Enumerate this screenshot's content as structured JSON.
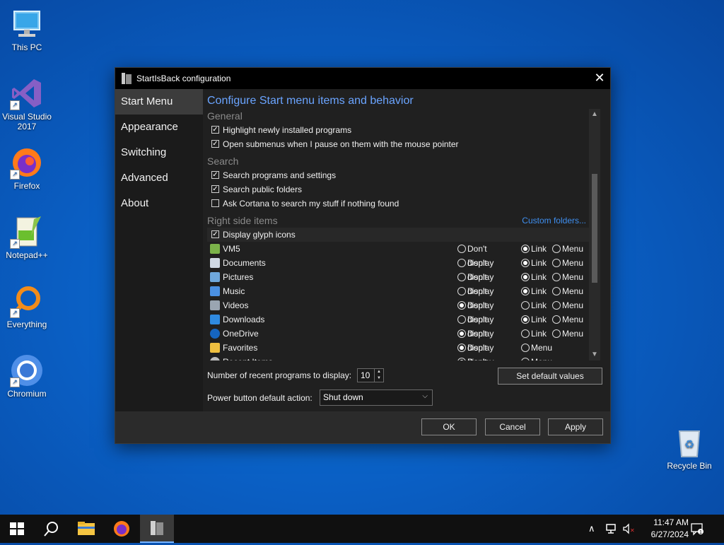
{
  "desktop": {
    "icons": [
      {
        "label": "This PC",
        "icon": "this-pc-icon"
      },
      {
        "label": "Visual Studio 2017",
        "icon": "visual-studio-icon"
      },
      {
        "label": "Firefox",
        "icon": "firefox-icon"
      },
      {
        "label": "Notepad++",
        "icon": "notepadpp-icon"
      },
      {
        "label": "Everything",
        "icon": "everything-icon"
      },
      {
        "label": "Chromium",
        "icon": "chromium-icon"
      },
      {
        "label": "Recycle Bin",
        "icon": "recycle-bin-icon"
      }
    ]
  },
  "dialog": {
    "title": "StartIsBack configuration",
    "close_glyph": "✕",
    "nav": [
      "Start Menu",
      "Appearance",
      "Switching",
      "Advanced",
      "About"
    ],
    "nav_selected": "Start Menu",
    "heading": "Configure Start menu items and behavior",
    "sections": {
      "general": "General",
      "search": "Search",
      "right_side": "Right side items"
    },
    "custom_folders": "Custom folders...",
    "options": {
      "highlight": {
        "label": "Highlight newly installed programs",
        "checked": true
      },
      "submenus": {
        "label": "Open submenus when I pause on them with the mouse pointer",
        "checked": true
      },
      "search_programs": {
        "label": "Search programs and settings",
        "checked": true
      },
      "search_public": {
        "label": "Search public folders",
        "checked": true
      },
      "cortana": {
        "label": "Ask Cortana to search my stuff if nothing found",
        "checked": false
      },
      "glyph_icons": {
        "label": "Display glyph icons",
        "checked": true
      }
    },
    "radio_labels": {
      "dont": "Don't display",
      "link": "Link",
      "menu": "Menu"
    },
    "right_items": [
      {
        "label": "VM5",
        "icon": "user-icon",
        "selected": "link"
      },
      {
        "label": "Documents",
        "icon": "documents-icon",
        "selected": "link"
      },
      {
        "label": "Pictures",
        "icon": "pictures-icon",
        "selected": "link"
      },
      {
        "label": "Music",
        "icon": "music-icon",
        "selected": "link"
      },
      {
        "label": "Videos",
        "icon": "videos-icon",
        "selected": "dont"
      },
      {
        "label": "Downloads",
        "icon": "downloads-icon",
        "selected": "link"
      },
      {
        "label": "OneDrive",
        "icon": "onedrive-icon",
        "selected": "dont"
      },
      {
        "label": "Favorites",
        "icon": "favorites-icon",
        "selected": "dont",
        "no_link": true
      },
      {
        "label": "Recent Items",
        "icon": "recent-items-icon",
        "selected": "dont",
        "no_link": true
      }
    ],
    "recent_label": "Number of recent programs to display:",
    "recent_value": "10",
    "power_label": "Power button default action:",
    "power_value": "Shut down",
    "set_default": "Set default values",
    "ok": "OK",
    "cancel": "Cancel",
    "apply": "Apply"
  },
  "taskbar": {
    "apps": [
      "start-icon",
      "search-icon",
      "file-explorer-icon",
      "firefox-icon",
      "startisback-icon"
    ],
    "time": "11:47 AM",
    "date": "6/27/2024",
    "tray_icons": [
      "chevron-up-icon",
      "network-icon",
      "volume-muted-icon",
      "notification-icon"
    ],
    "notification_count": "1"
  },
  "colors": {
    "accent": "#6aa4ff",
    "link": "#3f8ff0",
    "dialog_bg": "#202020"
  }
}
